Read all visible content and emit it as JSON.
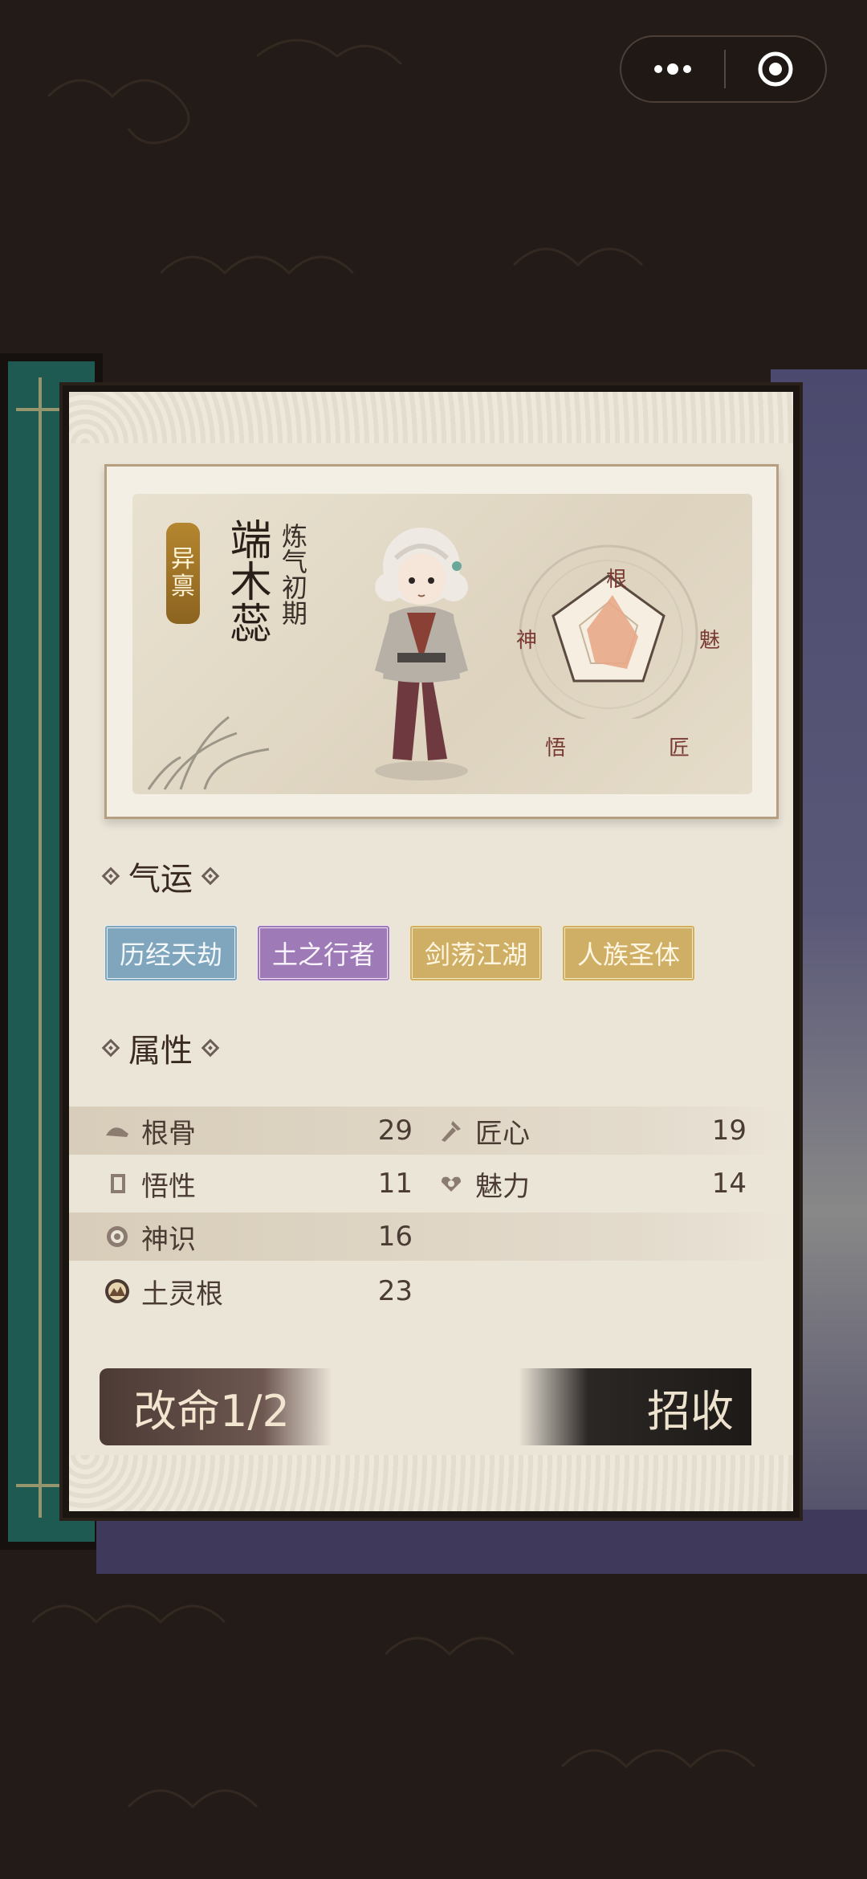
{
  "character": {
    "tag": [
      "异",
      "禀"
    ],
    "name": "端木蕊",
    "realm": "炼气初期"
  },
  "radar": {
    "labels": {
      "top": "根",
      "right": "魅",
      "bottom_right": "匠",
      "bottom_left": "悟",
      "left": "神"
    }
  },
  "fortune": {
    "title": "气运",
    "tags": [
      {
        "label": "历经天劫",
        "color": "blue"
      },
      {
        "label": "土之行者",
        "color": "purple"
      },
      {
        "label": "剑荡江湖",
        "color": "gold"
      },
      {
        "label": "人族圣体",
        "color": "gold"
      }
    ]
  },
  "attributes": {
    "title": "属性",
    "rows": [
      {
        "left": {
          "icon": "bone-icon",
          "label": "根骨",
          "value": "29"
        },
        "right": {
          "icon": "craft-icon",
          "label": "匠心",
          "value": "19"
        }
      },
      {
        "left": {
          "icon": "book-icon",
          "label": "悟性",
          "value": "11"
        },
        "right": {
          "icon": "charm-icon",
          "label": "魅力",
          "value": "14"
        }
      },
      {
        "left": {
          "icon": "spirit-icon",
          "label": "神识",
          "value": "16"
        }
      },
      {
        "left": {
          "icon": "earth-root-icon",
          "label": "土灵根",
          "value": "23"
        }
      }
    ]
  },
  "buttons": {
    "reroll": "改命1/2",
    "recruit": "招收"
  },
  "colors": {
    "card_bg": "#ebe5d8",
    "blue_tag": "#7fa6bd",
    "purple_tag": "#9e7bb7",
    "gold_tag": "#cfae66",
    "text_dark": "#4a3b33"
  }
}
